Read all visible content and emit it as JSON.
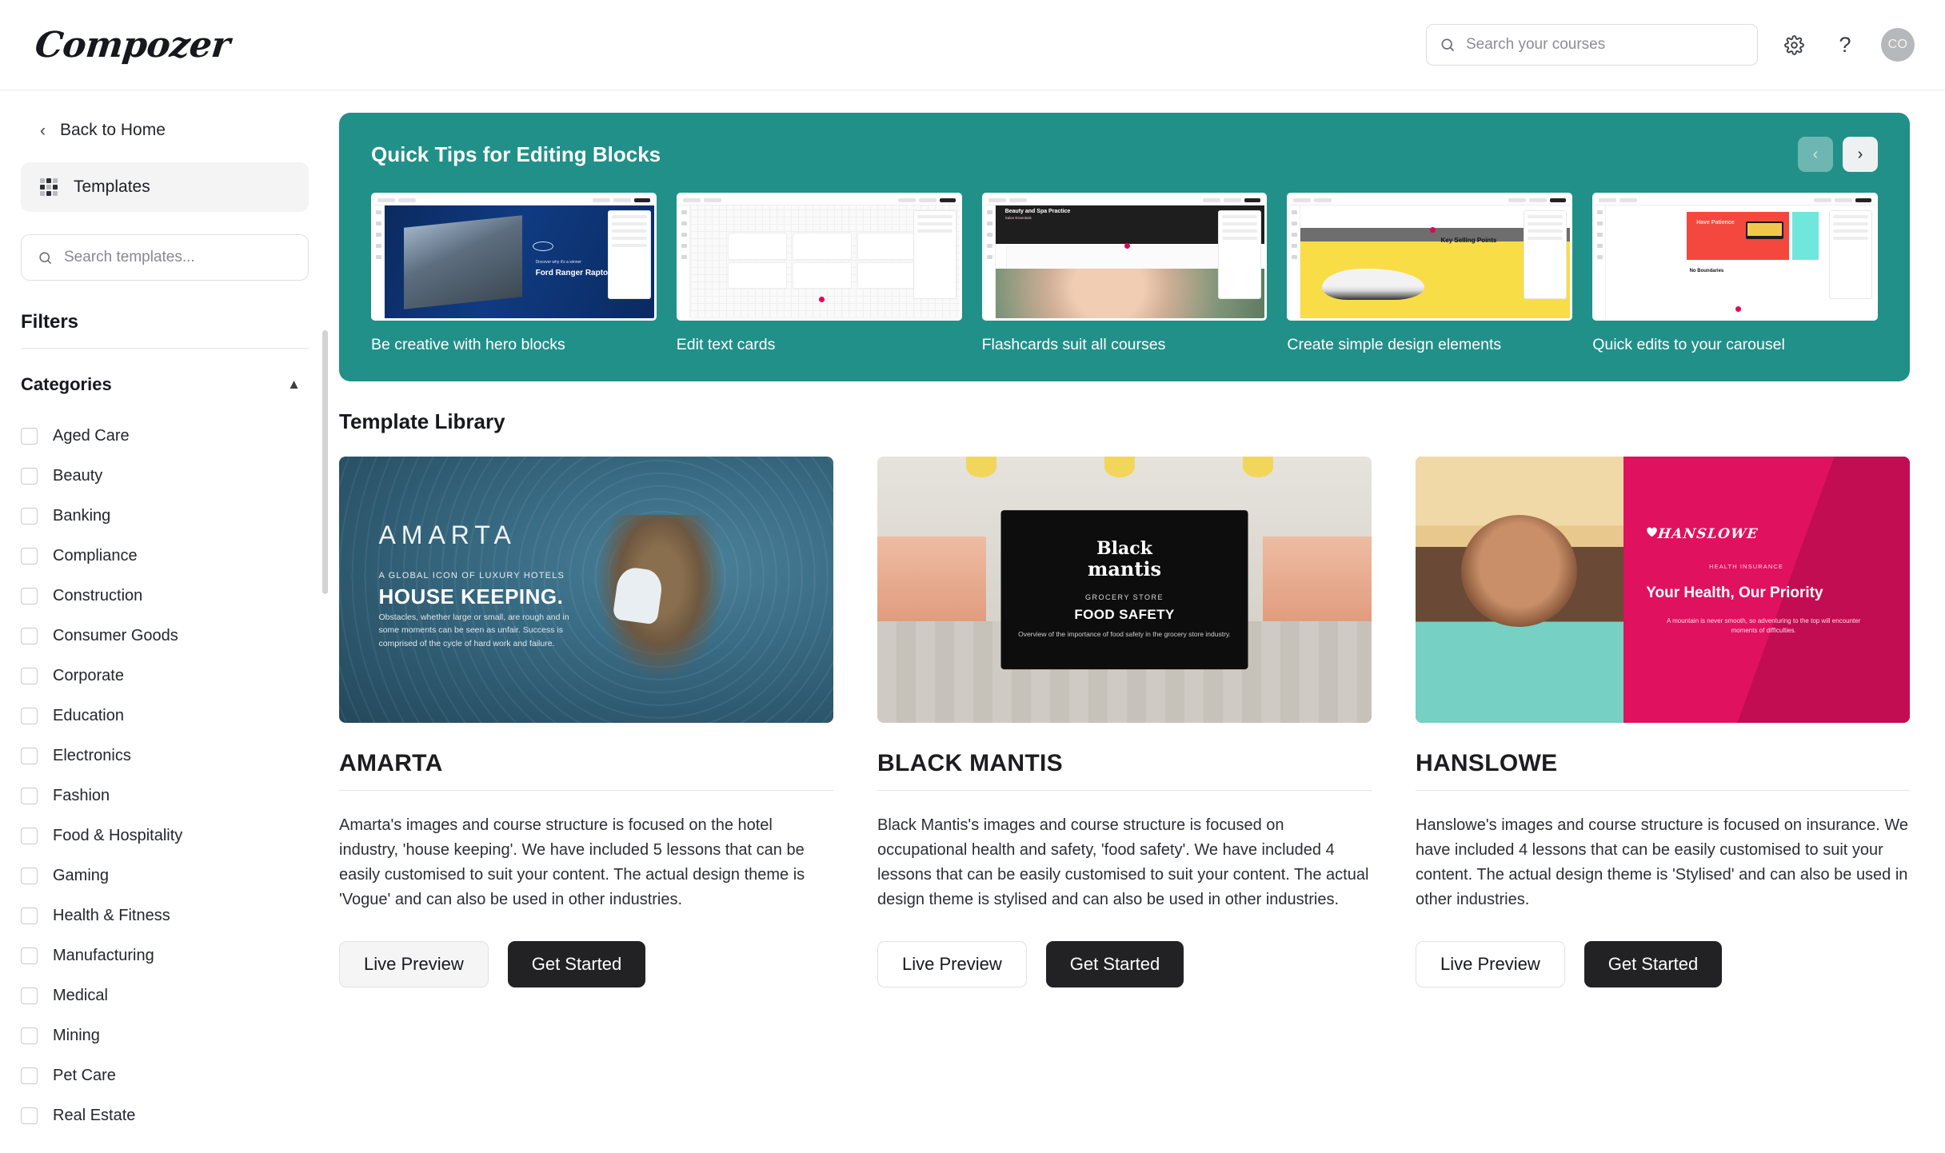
{
  "header": {
    "brand": "Compozer",
    "search_placeholder": "Search your courses",
    "search_value": "",
    "settings_icon": "gear-icon",
    "help_icon": "question-mark-icon",
    "avatar_initials": "CO"
  },
  "sidebar": {
    "back_label": "Back to Home",
    "nav_item": "Templates",
    "search_placeholder": "Search templates...",
    "filters_title": "Filters",
    "categories_title": "Categories",
    "categories": [
      "Aged Care",
      "Beauty",
      "Banking",
      "Compliance",
      "Construction",
      "Consumer Goods",
      "Corporate",
      "Education",
      "Electronics",
      "Fashion",
      "Food & Hospitality",
      "Gaming",
      "Health & Fitness",
      "Manufacturing",
      "Medical",
      "Mining",
      "Pet Care",
      "Real Estate"
    ]
  },
  "tips": {
    "title": "Quick Tips for Editing Blocks",
    "accent_color": "#219089",
    "prev_label": "‹",
    "next_label": "›",
    "items": [
      {
        "label": "Be creative with hero blocks",
        "preview_heading": "Ford Ranger Raptor",
        "preview_kicker": "Discover why it's a winner"
      },
      {
        "label": "Edit text cards",
        "preview_heading": "",
        "preview_kicker": ""
      },
      {
        "label": "Flashcards suit all courses",
        "preview_heading": "Beauty and Spa Practice",
        "preview_kicker": "Salon Essentials"
      },
      {
        "label": "Create simple design elements",
        "preview_heading": "Key Selling Points",
        "preview_kicker": ""
      },
      {
        "label": "Quick edits to your carousel",
        "preview_heading": "Have Patience",
        "preview_kicker": "No Boundaries"
      }
    ]
  },
  "library": {
    "title": "Template Library",
    "live_preview_label": "Live Preview",
    "get_started_label": "Get Started",
    "cards": [
      {
        "title": "AMARTA",
        "description": "Amarta's images and course structure is focused on the hotel industry, 'house keeping'. We have included 5 lessons that can be easily customised to suit your content. The actual design theme is 'Vogue' and can also be used in other industries.",
        "thumb_logo": "AMARTA",
        "thumb_kicker": "A GLOBAL ICON OF LUXURY HOTELS",
        "thumb_heading": "HOUSE KEEPING.",
        "thumb_body": "Obstacles, whether large or small, are rough and in some moments can be seen as unfair. Success is comprised of the cycle of hard work and failure."
      },
      {
        "title": "BLACK MANTIS",
        "description": "Black Mantis's images and course structure is focused on occupational health and safety, 'food safety'. We have included 4 lessons that can be easily customised to suit your content. The actual design theme is stylised and can also be used in other industries.",
        "thumb_logo_line1": "Black",
        "thumb_logo_line2": "mantis",
        "thumb_kicker": "GROCERY STORE",
        "thumb_heading": "FOOD SAFETY",
        "thumb_body": "Overview of the importance of food safety in the grocery store industry."
      },
      {
        "title": "HANSLOWE",
        "description": "Hanslowe's images and course structure is focused on insurance. We have included 4 lessons that can be easily customised to suit your content. The actual design theme is 'Stylised' and can also be used in other industries.",
        "thumb_logo": "HANSLOWE",
        "thumb_kicker": "HEALTH INSURANCE",
        "thumb_heading": "Your Health, Our Priority",
        "thumb_body": "A mountain is never smooth, so adventuring to the top will encounter moments of difficulties."
      }
    ]
  }
}
